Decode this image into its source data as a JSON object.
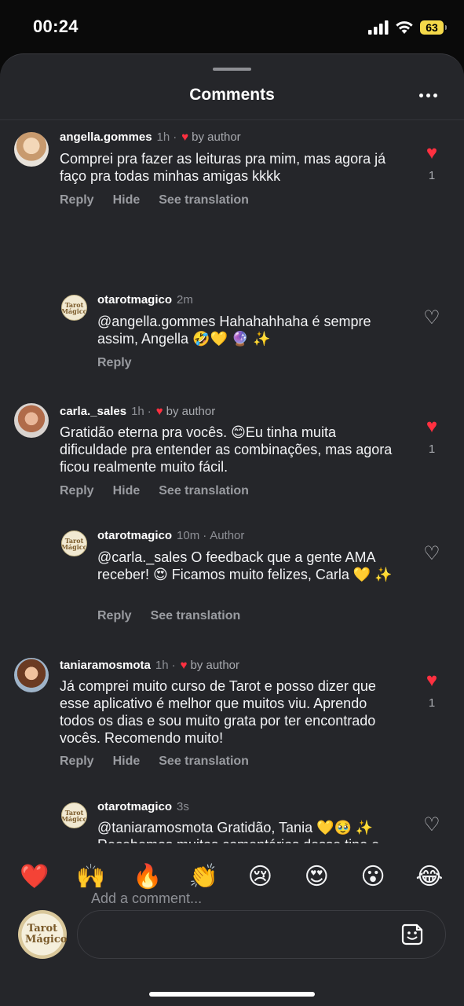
{
  "status_bar": {
    "time": "00:24",
    "battery": "63"
  },
  "sheet": {
    "title": "Comments"
  },
  "comments": [
    {
      "user": "angella.gommes",
      "time": "1h",
      "liked_by_author": true,
      "by_author_label": "by author",
      "text": "Comprei pra fazer as leituras pra mim, mas agora já faço pra todas minhas amigas kkkk",
      "actions": [
        "Reply",
        "Hide",
        "See translation"
      ],
      "likes": "1",
      "liked": true
    },
    {
      "user": "otarotmagico",
      "time": "2m",
      "author_label": "",
      "text": "@angella.gommes Hahahahhaha é sempre assim, Angella 🤣💛 🔮 ✨",
      "actions": [
        "Reply"
      ],
      "likes": "",
      "liked": false
    },
    {
      "user": "carla._sales",
      "time": "1h",
      "liked_by_author": true,
      "by_author_label": "by author",
      "text": "Gratidão eterna pra vocês. 😊Eu tinha muita dificuldade pra entender as combinações, mas agora ficou realmente muito fácil.",
      "actions": [
        "Reply",
        "Hide",
        "See translation"
      ],
      "likes": "1",
      "liked": true
    },
    {
      "user": "otarotmagico",
      "time": "10m",
      "author_label": "Author",
      "text": "@carla._sales O feedback que a gente AMA receber! 😍 Ficamos muito felizes, Carla 💛 ✨",
      "actions": [
        "Reply",
        "See translation"
      ],
      "likes": "",
      "liked": false
    },
    {
      "user": "taniaramosmota",
      "time": "1h",
      "liked_by_author": true,
      "by_author_label": "by author",
      "text": "Já comprei muito curso de Tarot e posso dizer que esse aplicativo é melhor que muitos viu. Aprendo todos os dias e sou muito grata por ter encontrado vocês. Recomendo muito!",
      "actions": [
        "Reply",
        "Hide",
        "See translation"
      ],
      "likes": "1",
      "liked": true
    },
    {
      "user": "otarotmagico",
      "time": "3s",
      "author_label": "",
      "text": "@taniaramosmota Gratidão, Tania 💛🥹 ✨ Recebemos muitos comentários desse tipo e ficamos felizes em estar presente nesses momentos de estudo 🔮",
      "actions": [],
      "likes": "",
      "liked": false
    }
  ],
  "emoji_reactions": [
    "❤️",
    "🙌",
    "🔥",
    "👏",
    "😢",
    "😍",
    "😮",
    "😂"
  ],
  "composer": {
    "placeholder": "Add a comment...",
    "avatar_text": "Tarot Mágico"
  },
  "icons": {
    "like": "heart-icon",
    "more": "more-icon",
    "sticker": "sticker-icon",
    "signal": "signal-icon",
    "wifi": "wifi-icon",
    "battery": "battery-icon"
  },
  "colors": {
    "accent_red": "#ff3040",
    "sheet_bg": "#25262a",
    "battery": "#f5d94a"
  }
}
